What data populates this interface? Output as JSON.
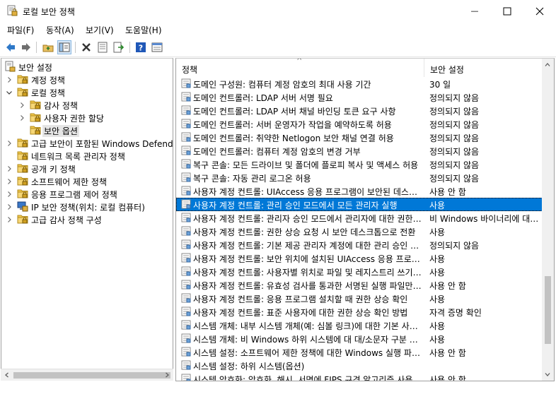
{
  "window": {
    "title": "로컬 보안 정책",
    "minimize_glyph": "—",
    "icons": {
      "app": "local-security-policy-icon"
    }
  },
  "menu": [
    "파일(F)",
    "동작(A)",
    "보기(V)",
    "도움말(H)"
  ],
  "toolbar": {
    "buttons": [
      "back-icon",
      "forward-icon",
      "up-folder-icon",
      "show-hide-tree-icon",
      "delete-icon",
      "properties-icon",
      "export-icon",
      "help-icon",
      "console-icon"
    ]
  },
  "tree": {
    "items": [
      {
        "label": "보안 설정",
        "level": 0,
        "expanded": true,
        "icon": "security-settings-icon"
      },
      {
        "label": "계정 정책",
        "level": 1,
        "expanded": false,
        "icon": "folder-icon"
      },
      {
        "label": "로컬 정책",
        "level": 1,
        "expanded": true,
        "icon": "folder-icon"
      },
      {
        "label": "감사 정책",
        "level": 2,
        "expanded": false,
        "icon": "folder-icon"
      },
      {
        "label": "사용자 권한 할당",
        "level": 2,
        "expanded": false,
        "icon": "folder-icon"
      },
      {
        "label": "보안 옵션",
        "level": 2,
        "expanded": null,
        "icon": "folder-icon",
        "selected": true
      },
      {
        "label": "고급 보안이 포함된 Windows Defende",
        "level": 1,
        "expanded": false,
        "icon": "folder-icon"
      },
      {
        "label": "네트워크 목록 관리자 정책",
        "level": 1,
        "expanded": null,
        "icon": "folder-icon"
      },
      {
        "label": "공개 키 정책",
        "level": 1,
        "expanded": false,
        "icon": "folder-icon"
      },
      {
        "label": "소프트웨어 제한 정책",
        "level": 1,
        "expanded": false,
        "icon": "folder-icon"
      },
      {
        "label": "응용 프로그램 제어 정책",
        "level": 1,
        "expanded": false,
        "icon": "folder-icon"
      },
      {
        "label": "IP 보안 정책(위치: 로컬 컴퓨터)",
        "level": 1,
        "expanded": false,
        "icon": "ip-security-icon"
      },
      {
        "label": "고급 감사 정책 구성",
        "level": 1,
        "expanded": false,
        "icon": "folder-icon"
      }
    ]
  },
  "list": {
    "columns": {
      "policy": "정책",
      "setting": "보안 설정"
    },
    "sort_indicator": "^",
    "selected_index": 9,
    "rows": [
      {
        "policy": "도메인 구성원: 컴퓨터 계정 암호의 최대 사용 기간",
        "setting": "30 일"
      },
      {
        "policy": "도메인 컨트롤러: LDAP 서버 서명 필요",
        "setting": "정의되지 않음"
      },
      {
        "policy": "도메인 컨트롤러: LDAP 서버 채널 바인딩 토큰 요구 사항",
        "setting": "정의되지 않음"
      },
      {
        "policy": "도메인 컨트롤러: 서버 운영자가 작업을 예약하도록 허용",
        "setting": "정의되지 않음"
      },
      {
        "policy": "도메인 컨트롤러: 취약한 Netlogon 보안 채널 연결 허용",
        "setting": "정의되지 않음"
      },
      {
        "policy": "도메인 컨트롤러: 컴퓨터 계정 암호의 변경 거부",
        "setting": "정의되지 않음"
      },
      {
        "policy": "복구 콘솔: 모든 드라이브 및 폴더에 플로피 복사 및 액세스 허용",
        "setting": "정의되지 않음"
      },
      {
        "policy": "복구 콘솔: 자동 관리 로그온 허용",
        "setting": "정의되지 않음"
      },
      {
        "policy": "사용자 계정 컨트롤: UIAccess 응용 프로그램이 보안된 데스크톱을 사용하지 않고 권한 상승 요청",
        "setting": "사용 안 함"
      },
      {
        "policy": "사용자 계정 컨트롤: 관리 승인 모드에서 모든 관리자 실행",
        "setting": "사용"
      },
      {
        "policy": "사용자 계정 컨트롤: 관리자 승인 모드에서 관리자에 대한 권한 상승 확인 메시지 동작",
        "setting": "비 Windows 바이너리에 대한 동의 요청"
      },
      {
        "policy": "사용자 계정 컨트롤: 권한 상승 요청 시 보안 데스크톱으로 전환",
        "setting": "사용"
      },
      {
        "policy": "사용자 계정 컨트롤: 기본 제공 관리자 계정에 대한 관리 승인 모드",
        "setting": "정의되지 않음"
      },
      {
        "policy": "사용자 계정 컨트롤: 보안 위치에 설치된 UIAccess 응용 프로그램만 권한 상승",
        "setting": "사용"
      },
      {
        "policy": "사용자 계정 컨트롤: 사용자별 위치로 파일 및 레지스트리 쓰기 실패 가상화",
        "setting": "사용"
      },
      {
        "policy": "사용자 계정 컨트롤: 유효성 검사를 통과한 서명된 실행 파일만 권한 상승",
        "setting": "사용 안 함"
      },
      {
        "policy": "사용자 계정 컨트롤: 응용 프로그램 설치할 때 권한 상승 확인",
        "setting": "사용"
      },
      {
        "policy": "사용자 계정 컨트롤: 표준 사용자에 대한 권한 상승 확인 방법",
        "setting": "자격 증명 확인"
      },
      {
        "policy": "시스템 개체: 내부 시스템 개체(예: 심볼 링크)에 대한 기본 사용 권한 강화",
        "setting": "사용"
      },
      {
        "policy": "시스템 개체: 비 Windows 하위 시스템에 대 대/소문자 구분 필요",
        "setting": "사용"
      },
      {
        "policy": "시스템 설정: 소프트웨어 제한 정책에 대한 Windows 실행 파일에 인증서 규칙 사용",
        "setting": "사용 안 함"
      },
      {
        "policy": "시스템 설정: 하위 시스템(옵션)",
        "setting": ""
      },
      {
        "policy": "시스템 암호화: 암호화, 해시, 서명에 FIPS 규격 알고리즘 사용",
        "setting": "사용 안 함"
      }
    ]
  }
}
